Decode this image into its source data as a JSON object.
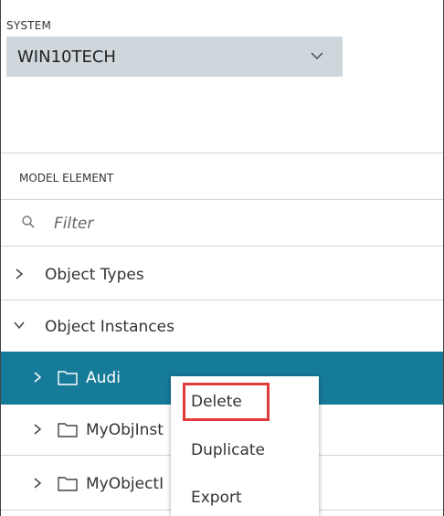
{
  "system": {
    "label": "SYSTEM",
    "selected_value": "WIN10TECH"
  },
  "model_element": {
    "label": "MODEL ELEMENT",
    "filter_placeholder": "Filter"
  },
  "tree": [
    {
      "label": "Object Types",
      "expanded": false
    },
    {
      "label": "Object Instances",
      "expanded": true
    },
    {
      "label": "Audi",
      "selected": true
    },
    {
      "label": "MyObjInst"
    },
    {
      "label": "MyObjectI"
    }
  ],
  "context_menu": {
    "items": [
      "Delete",
      "Duplicate",
      "Export"
    ],
    "highlighted": "Delete",
    "highlight_color": "#e03b3b"
  },
  "colors": {
    "selected_row": "#167b98",
    "select_bg": "#cfd7dc"
  }
}
